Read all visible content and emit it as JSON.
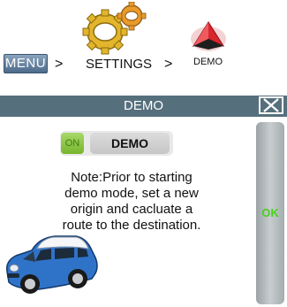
{
  "breadcrumb": {
    "menu_label": "MENU",
    "separator": ">",
    "settings_label": "SETTINGS",
    "demo_label": "DEMO",
    "settings_icon": "gears-icon",
    "demo_icon": "navigation-arrow-icon"
  },
  "dialog": {
    "title": "DEMO",
    "close_icon": "close-icon",
    "toggle_state": "ON",
    "toggle_label": "DEMO",
    "note": "Note:Prior to starting demo mode, set a new origin and cacluate a route to the destination.",
    "ok_label": "OK",
    "illustration": "blue-mini-car"
  },
  "colors": {
    "title_bar": "#566f7d",
    "toggle_on": "#8cc63f",
    "ok_text": "#47d11d",
    "menu_button": "#5f7fa1"
  }
}
